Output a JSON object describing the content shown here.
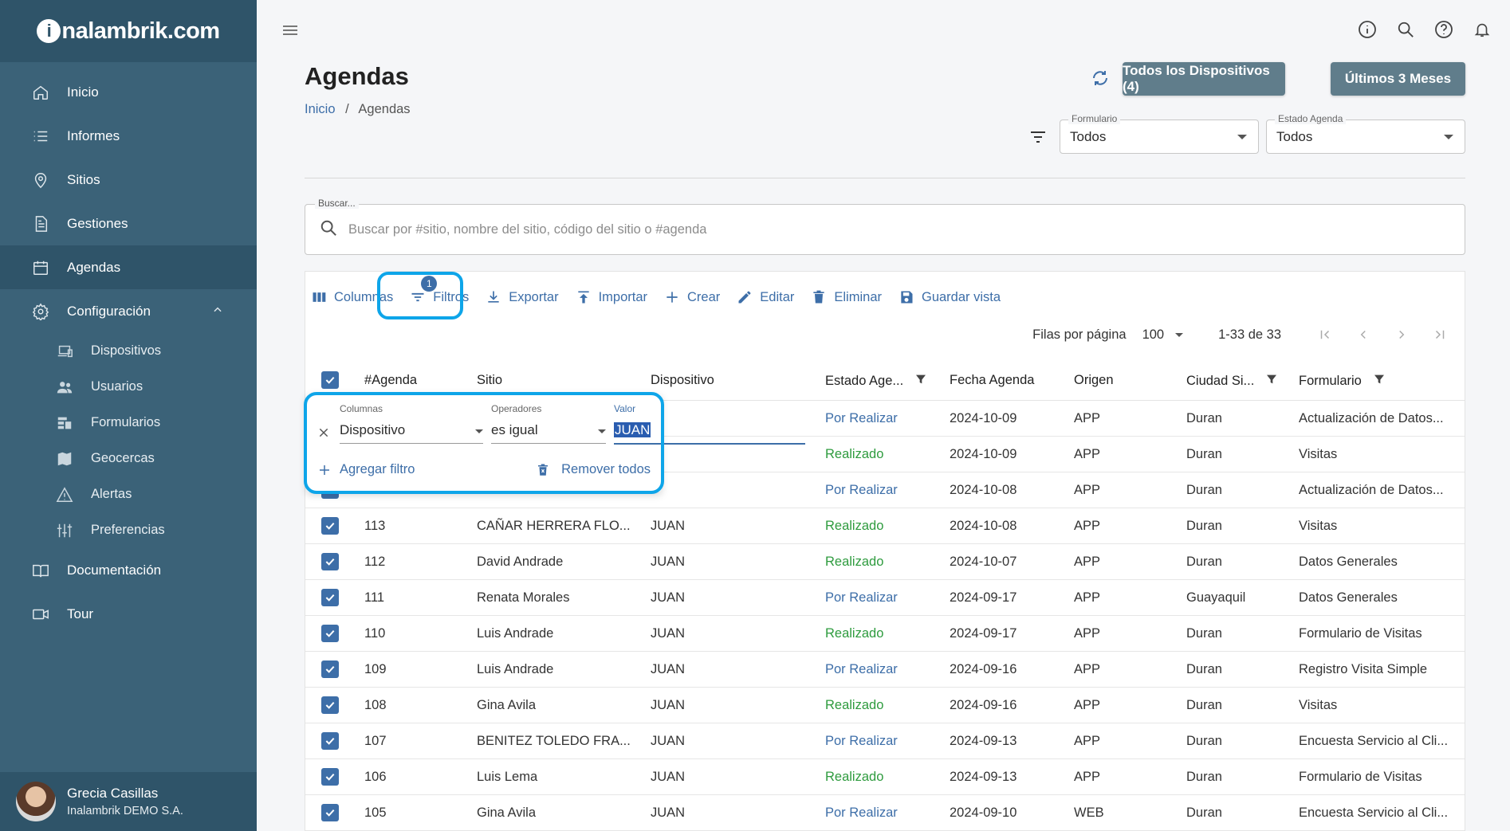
{
  "brand": {
    "logo_text": "nalambrik.com",
    "logo_mark": "i"
  },
  "sidebar": {
    "items": [
      {
        "label": "Inicio",
        "icon": "home-icon"
      },
      {
        "label": "Informes",
        "icon": "list-icon"
      },
      {
        "label": "Sitios",
        "icon": "location-icon"
      },
      {
        "label": "Gestiones",
        "icon": "document-icon"
      },
      {
        "label": "Agendas",
        "icon": "calendar-icon",
        "active": true
      },
      {
        "label": "Configuración",
        "icon": "gear-icon",
        "expanded": true
      }
    ],
    "sub_items": [
      {
        "label": "Dispositivos",
        "icon": "devices-icon"
      },
      {
        "label": "Usuarios",
        "icon": "users-icon"
      },
      {
        "label": "Formularios",
        "icon": "forms-icon"
      },
      {
        "label": "Geocercas",
        "icon": "map-icon"
      },
      {
        "label": "Alertas",
        "icon": "warning-icon"
      },
      {
        "label": "Preferencias",
        "icon": "sliders-icon"
      }
    ],
    "bottom_items": [
      {
        "label": "Documentación",
        "icon": "book-icon"
      },
      {
        "label": "Tour",
        "icon": "video-icon"
      }
    ],
    "user": {
      "name": "Grecia Casillas",
      "company": "Inalambrik DEMO S.A."
    }
  },
  "header": {
    "title": "Agendas",
    "breadcrumb": {
      "home": "Inicio",
      "separator": "/",
      "current": "Agendas"
    },
    "btn_devices": "Todos los Dispositivos (4)",
    "btn_period": "Últimos 3 Meses",
    "formulario": {
      "label": "Formulario",
      "value": "Todos"
    },
    "estado": {
      "label": "Estado Agenda",
      "value": "Todos"
    }
  },
  "search": {
    "label": "Buscar...",
    "placeholder": "Buscar por #sitio, nombre del sitio, código del sitio o #agenda"
  },
  "toolbar": {
    "columnas": "Columnas",
    "filtros": "Filtros",
    "filtros_count": "1",
    "exportar": "Exportar",
    "importar": "Importar",
    "crear": "Crear",
    "editar": "Editar",
    "eliminar": "Eliminar",
    "guardar": "Guardar vista"
  },
  "pagination": {
    "rows_label": "Filas por página",
    "rows_value": "100",
    "range": "1-33 de 33"
  },
  "table": {
    "headers": {
      "agenda": "#Agenda",
      "sitio": "Sitio",
      "dispositivo": "Dispositivo",
      "estado": "Estado Age...",
      "fecha": "Fecha Agenda",
      "origen": "Origen",
      "ciudad": "Ciudad Si...",
      "formulario": "Formulario"
    },
    "rows": [
      {
        "agenda": "",
        "sitio": "",
        "dispositivo": "",
        "estado": "Por Realizar",
        "fecha": "2024-10-09",
        "origen": "APP",
        "ciudad": "Duran",
        "formulario": "Actualización de Datos..."
      },
      {
        "agenda": "",
        "sitio": "",
        "dispositivo": "",
        "estado": "Realizado",
        "fecha": "2024-10-09",
        "origen": "APP",
        "ciudad": "Duran",
        "formulario": "Visitas"
      },
      {
        "agenda": "",
        "sitio": "",
        "dispositivo": "",
        "estado": "Por Realizar",
        "fecha": "2024-10-08",
        "origen": "APP",
        "ciudad": "Duran",
        "formulario": "Actualización de Datos..."
      },
      {
        "agenda": "113",
        "sitio": "CAÑAR HERRERA FLO...",
        "dispositivo": "JUAN",
        "estado": "Realizado",
        "fecha": "2024-10-08",
        "origen": "APP",
        "ciudad": "Duran",
        "formulario": "Visitas"
      },
      {
        "agenda": "112",
        "sitio": "David Andrade",
        "dispositivo": "JUAN",
        "estado": "Realizado",
        "fecha": "2024-10-07",
        "origen": "APP",
        "ciudad": "Duran",
        "formulario": "Datos Generales"
      },
      {
        "agenda": "111",
        "sitio": "Renata Morales",
        "dispositivo": "JUAN",
        "estado": "Por Realizar",
        "fecha": "2024-09-17",
        "origen": "APP",
        "ciudad": "Guayaquil",
        "formulario": "Datos Generales"
      },
      {
        "agenda": "110",
        "sitio": "Luis Andrade",
        "dispositivo": "JUAN",
        "estado": "Realizado",
        "fecha": "2024-09-17",
        "origen": "APP",
        "ciudad": "Duran",
        "formulario": "Formulario de Visitas"
      },
      {
        "agenda": "109",
        "sitio": "Luis Andrade",
        "dispositivo": "JUAN",
        "estado": "Por Realizar",
        "fecha": "2024-09-16",
        "origen": "APP",
        "ciudad": "Duran",
        "formulario": "Registro Visita Simple"
      },
      {
        "agenda": "108",
        "sitio": "Gina Avila",
        "dispositivo": "JUAN",
        "estado": "Realizado",
        "fecha": "2024-09-16",
        "origen": "APP",
        "ciudad": "Duran",
        "formulario": "Visitas"
      },
      {
        "agenda": "107",
        "sitio": "BENITEZ TOLEDO FRA...",
        "dispositivo": "JUAN",
        "estado": "Por Realizar",
        "fecha": "2024-09-13",
        "origen": "APP",
        "ciudad": "Duran",
        "formulario": "Encuesta Servicio al Cli..."
      },
      {
        "agenda": "106",
        "sitio": "Luis Lema",
        "dispositivo": "JUAN",
        "estado": "Realizado",
        "fecha": "2024-09-13",
        "origen": "APP",
        "ciudad": "Duran",
        "formulario": "Formulario de Visitas"
      },
      {
        "agenda": "105",
        "sitio": "Gina Avila",
        "dispositivo": "JUAN",
        "estado": "Por Realizar",
        "fecha": "2024-09-10",
        "origen": "WEB",
        "ciudad": "Duran",
        "formulario": "Encuesta Servicio al Cli..."
      }
    ]
  },
  "filter_panel": {
    "col_label": "Columnas",
    "col_value": "Dispositivo",
    "op_label": "Operadores",
    "op_value": "es igual",
    "val_label": "Valor",
    "val_value": "JUAN",
    "add": "Agregar filtro",
    "remove_all": "Remover todos"
  },
  "colors": {
    "sidebar": "#3b6278",
    "sidebar_dark": "#2f5469",
    "accent": "#3d6ea8",
    "done": "#2e9b3e",
    "highlight": "#0ea5e9",
    "button": "#607d8b"
  }
}
